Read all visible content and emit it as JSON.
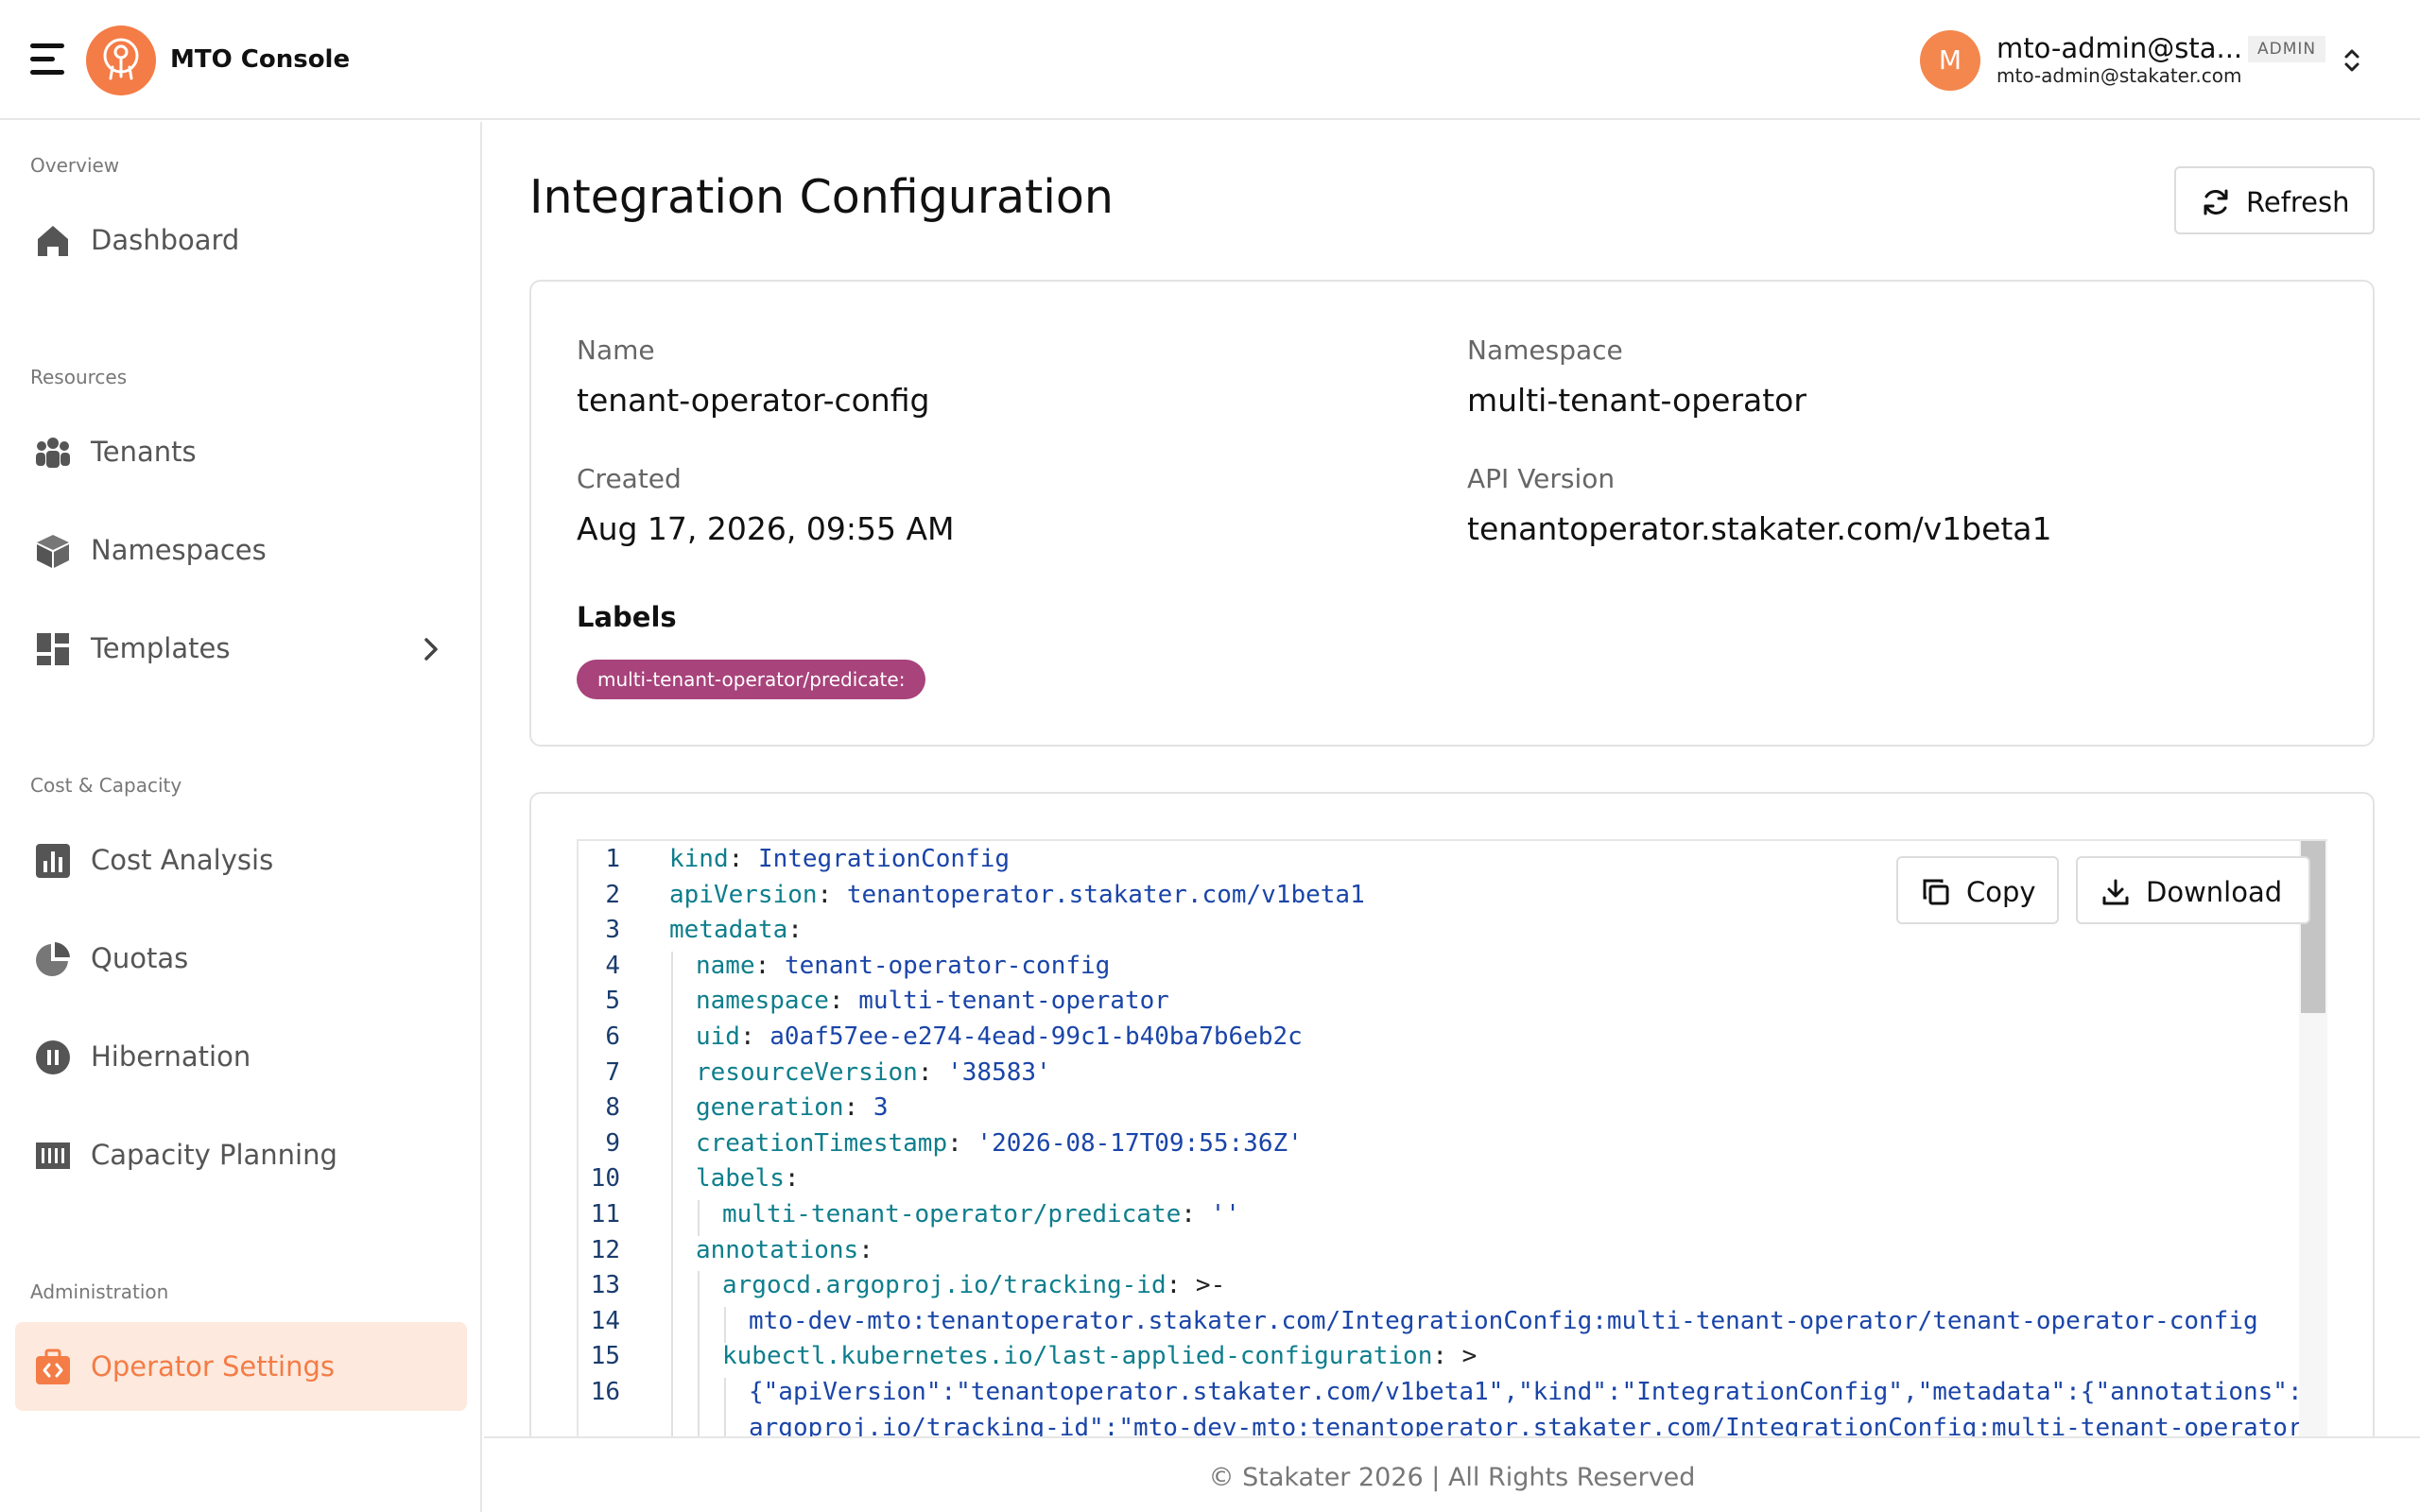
{
  "header": {
    "app_title": "MTO Console",
    "user_initial": "M",
    "user_name": "mto-admin@sta...",
    "user_role": "ADMIN",
    "user_email": "mto-admin@stakater.com"
  },
  "sidebar": {
    "sections": {
      "overview": "Overview",
      "resources": "Resources",
      "cost_capacity": "Cost & Capacity",
      "administration": "Administration"
    },
    "items": {
      "dashboard": "Dashboard",
      "tenants": "Tenants",
      "namespaces": "Namespaces",
      "templates": "Templates",
      "cost_analysis": "Cost Analysis",
      "quotas": "Quotas",
      "hibernation": "Hibernation",
      "capacity_planning": "Capacity Planning",
      "operator_settings": "Operator Settings"
    }
  },
  "page": {
    "title": "Integration Configuration",
    "refresh_label": "Refresh"
  },
  "details": {
    "name_label": "Name",
    "name_value": "tenant-operator-config",
    "namespace_label": "Namespace",
    "namespace_value": "multi-tenant-operator",
    "created_label": "Created",
    "created_value": "Aug 17, 2026, 09:55 AM",
    "api_version_label": "API Version",
    "api_version_value": "tenantoperator.stakater.com/v1beta1",
    "labels_title": "Labels",
    "label_chip": "multi-tenant-operator/predicate:"
  },
  "editor": {
    "copy_label": "Copy",
    "download_label": "Download",
    "lines": [
      {
        "n": "1",
        "indent": 0,
        "key": "kind",
        "sep": ": ",
        "val": "IntegrationConfig"
      },
      {
        "n": "2",
        "indent": 0,
        "key": "apiVersion",
        "sep": ": ",
        "val": "tenantoperator.stakater.com/v1beta1"
      },
      {
        "n": "3",
        "indent": 0,
        "key": "metadata",
        "sep": ":",
        "val": ""
      },
      {
        "n": "4",
        "indent": 1,
        "key": "name",
        "sep": ": ",
        "val": "tenant-operator-config"
      },
      {
        "n": "5",
        "indent": 1,
        "key": "namespace",
        "sep": ": ",
        "val": "multi-tenant-operator"
      },
      {
        "n": "6",
        "indent": 1,
        "key": "uid",
        "sep": ": ",
        "val": "a0af57ee-e274-4ead-99c1-b40ba7b6eb2c"
      },
      {
        "n": "7",
        "indent": 1,
        "key": "resourceVersion",
        "sep": ": ",
        "val": "'38583'"
      },
      {
        "n": "8",
        "indent": 1,
        "key": "generation",
        "sep": ": ",
        "val": "3"
      },
      {
        "n": "9",
        "indent": 1,
        "key": "creationTimestamp",
        "sep": ": ",
        "val": "'2026-08-17T09:55:36Z'"
      },
      {
        "n": "10",
        "indent": 1,
        "key": "labels",
        "sep": ":",
        "val": ""
      },
      {
        "n": "11",
        "indent": 2,
        "key": "multi-tenant-operator/predicate",
        "sep": ": ",
        "val": "''"
      },
      {
        "n": "12",
        "indent": 1,
        "key": "annotations",
        "sep": ":",
        "val": ""
      },
      {
        "n": "13",
        "indent": 2,
        "key": "argocd.argoproj.io/tracking-id",
        "sep": ": >-",
        "val": ""
      },
      {
        "n": "14",
        "indent": 3,
        "key": "",
        "sep": "",
        "val": "mto-dev-mto:tenantoperator.stakater.com/IntegrationConfig:multi-tenant-operator/tenant-operator-config"
      },
      {
        "n": "15",
        "indent": 2,
        "key": "kubectl.kubernetes.io/last-applied-configuration",
        "sep": ": >",
        "val": ""
      },
      {
        "n": "16",
        "indent": 3,
        "key": "",
        "sep": "",
        "val": "{\"apiVersion\":\"tenantoperator.stakater.com/v1beta1\",\"kind\":\"IntegrationConfig\",\"metadata\":{\"annotations\":{\"argocd."
      },
      {
        "n": "",
        "indent": 3,
        "key": "",
        "sep": "",
        "val": "argoproj.io/tracking-id\":\"mto-dev-mto:tenantoperator.stakater.com/IntegrationConfig:multi-tenant-operator/"
      }
    ]
  },
  "footer": {
    "text": "© Stakater 2026 | All Rights Reserved"
  },
  "colors": {
    "accent": "#f47c46",
    "active_bg": "#fde9dd",
    "label_chip": "#a8437b",
    "code_key": "#0e7e8c",
    "code_value": "#1a45a8"
  }
}
